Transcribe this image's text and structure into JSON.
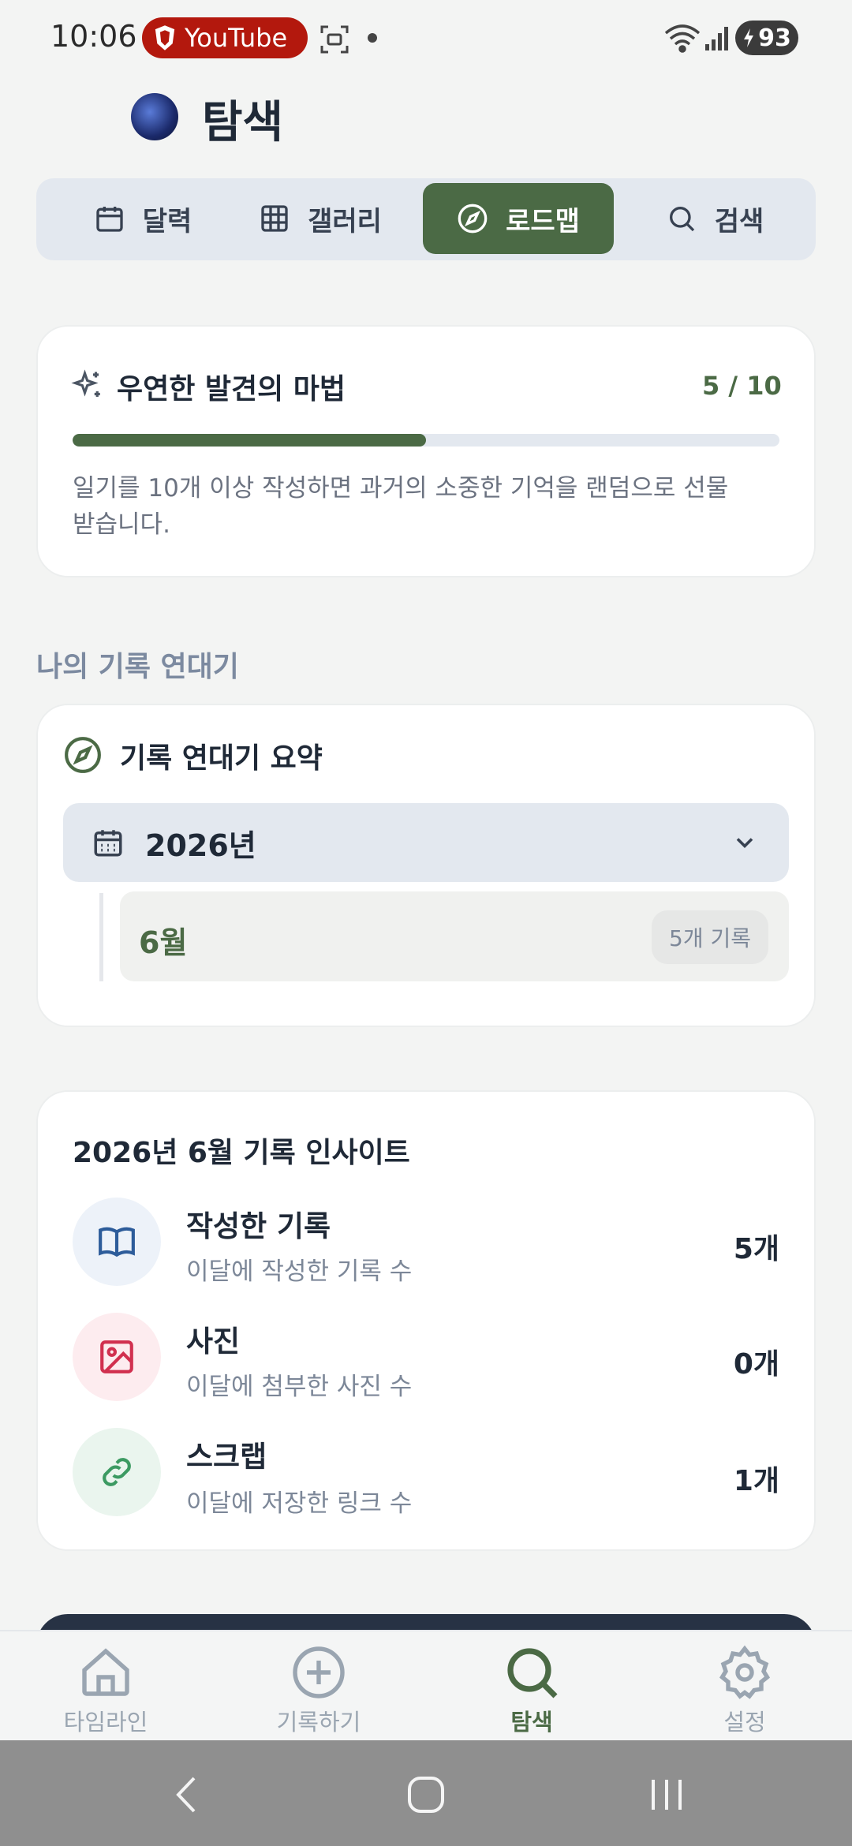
{
  "status_bar": {
    "time": "10:06",
    "notification_app": "YouTube",
    "battery": "93"
  },
  "header": {
    "title": "탐색"
  },
  "tabs": [
    {
      "label": "달력",
      "icon": "calendar-icon",
      "active": false
    },
    {
      "label": "갤러리",
      "icon": "grid-icon",
      "active": false
    },
    {
      "label": "로드맵",
      "icon": "compass-icon",
      "active": true
    },
    {
      "label": "검색",
      "icon": "search-icon",
      "active": false
    }
  ],
  "magic_card": {
    "title": "우연한 발견의 마법",
    "count": "5 / 10",
    "progress": 0.5,
    "description": "일기를 10개 이상 작성하면 과거의 소중한 기억을 랜덤으로 선물 받습니다."
  },
  "section_label": "나의 기록 연대기",
  "chronicle": {
    "title": "기록 연대기 요약",
    "year": "2026년",
    "month": "6월",
    "month_badge": "5개 기록"
  },
  "insights": {
    "title": "2026년 6월 기록 인사이트",
    "items": [
      {
        "title": "작성한 기록",
        "subtitle": "이달에 작성한 기록 수",
        "value": "5개",
        "icon": "book-icon",
        "color": "#2d5c9a",
        "bg": "#edf2f9"
      },
      {
        "title": "사진",
        "subtitle": "이달에 첨부한 사진 수",
        "value": "0개",
        "icon": "image-icon",
        "color": "#d1304f",
        "bg": "#fdecef"
      },
      {
        "title": "스크랩",
        "subtitle": "이달에 저장한 링크 수",
        "value": "1개",
        "icon": "link-icon",
        "color": "#3c9a62",
        "bg": "#eaf5ee"
      }
    ]
  },
  "bottom_nav": [
    {
      "label": "타임라인",
      "icon": "home-icon",
      "active": false
    },
    {
      "label": "기록하기",
      "icon": "plus-circle-icon",
      "active": false
    },
    {
      "label": "탐색",
      "icon": "search-icon",
      "active": true
    },
    {
      "label": "설정",
      "icon": "gear-icon",
      "active": false
    }
  ],
  "colors": {
    "accent": "#4b6a45",
    "tab_bg": "#e3e8ef",
    "page_bg": "#f3f4f3"
  }
}
